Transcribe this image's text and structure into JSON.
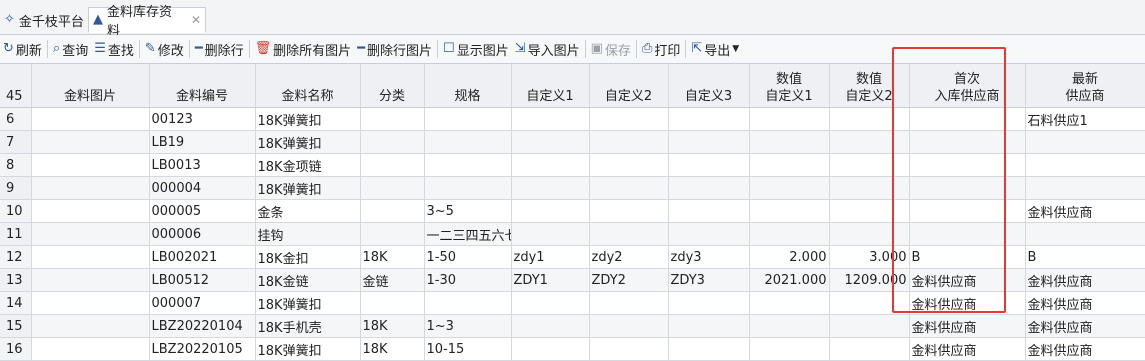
{
  "tabs": {
    "home_label": "金千枝平台",
    "active_label": "金料库存资料",
    "close_glyph": "✕"
  },
  "toolbar": {
    "refresh": "刷新",
    "query": "查询",
    "find": "查找",
    "edit": "修改",
    "delete_row": "删除行",
    "delete_all_images": "删除所有图片",
    "delete_row_image": "删除行图片",
    "show_image": "显示图片",
    "import_image": "导入图片",
    "save": "保存",
    "print": "打印",
    "export": "导出"
  },
  "grid": {
    "row_count": "45",
    "columns": {
      "image": "金料图片",
      "code": "金料编号",
      "name": "金料名称",
      "category": "分类",
      "spec": "规格",
      "custom1": "自定义1",
      "custom2": "自定义2",
      "custom3": "自定义3",
      "num1_l1": "数值",
      "num1_l2": "自定义1",
      "num2_l1": "数值",
      "num2_l2": "自定义2",
      "first_l1": "首次",
      "first_l2": "入库供应商",
      "latest_l1": "最新",
      "latest_l2": "供应商"
    },
    "rows": [
      {
        "n": "6",
        "code": "00123",
        "name": "18K弹簧扣",
        "cat": "",
        "spec": "",
        "c1": "",
        "c2": "",
        "c3": "",
        "v1": "",
        "v2": "",
        "first": "",
        "latest": "石料供应1"
      },
      {
        "n": "7",
        "code": "LB19",
        "name": "18K弹簧扣",
        "cat": "",
        "spec": "",
        "c1": "",
        "c2": "",
        "c3": "",
        "v1": "",
        "v2": "",
        "first": "",
        "latest": ""
      },
      {
        "n": "8",
        "code": "LB0013",
        "name": "18K金项链",
        "cat": "",
        "spec": "",
        "c1": "",
        "c2": "",
        "c3": "",
        "v1": "",
        "v2": "",
        "first": "",
        "latest": ""
      },
      {
        "n": "9",
        "code": "000004",
        "name": "18K弹簧扣",
        "cat": "",
        "spec": "",
        "c1": "",
        "c2": "",
        "c3": "",
        "v1": "",
        "v2": "",
        "first": "",
        "latest": ""
      },
      {
        "n": "10",
        "code": "000005",
        "name": "金条",
        "cat": "",
        "spec": "3~5",
        "c1": "",
        "c2": "",
        "c3": "",
        "v1": "",
        "v2": "",
        "first": "",
        "latest": "金料供应商"
      },
      {
        "n": "11",
        "code": "000006",
        "name": "挂钩",
        "cat": "",
        "spec": "一二三四五六七",
        "c1": "",
        "c2": "",
        "c3": "",
        "v1": "",
        "v2": "",
        "first": "",
        "latest": ""
      },
      {
        "n": "12",
        "code": "LB002021",
        "name": "18K金扣",
        "cat": "18K",
        "spec": "1-50",
        "c1": "zdy1",
        "c2": "zdy2",
        "c3": "zdy3",
        "v1": "2.000",
        "v2": "3.000",
        "first": "B",
        "latest": "B"
      },
      {
        "n": "13",
        "code": "LB00512",
        "name": "18K金链",
        "cat": "金链",
        "spec": "1-30",
        "c1": "ZDY1",
        "c2": "ZDY2",
        "c3": "ZDY3",
        "v1": "2021.000",
        "v2": "1209.000",
        "first": "金料供应商",
        "latest": "金料供应商"
      },
      {
        "n": "14",
        "code": "000007",
        "name": "18K弹簧扣",
        "cat": "",
        "spec": "",
        "c1": "",
        "c2": "",
        "c3": "",
        "v1": "",
        "v2": "",
        "first": "金料供应商",
        "latest": "金料供应商"
      },
      {
        "n": "15",
        "code": "LBZ20220104",
        "name": "18K手机壳",
        "cat": "18K",
        "spec": "1~3",
        "c1": "",
        "c2": "",
        "c3": "",
        "v1": "",
        "v2": "",
        "first": "金料供应商",
        "latest": "金料供应商"
      },
      {
        "n": "16",
        "code": "LBZ20220105",
        "name": "18K弹簧扣",
        "cat": "18K",
        "spec": "10-15",
        "c1": "",
        "c2": "",
        "c3": "",
        "v1": "",
        "v2": "",
        "first": "金料供应商",
        "latest": "金料供应商"
      }
    ]
  },
  "colors": {
    "highlight_border": "#e53935",
    "toolbar_icon": "#2d5a99",
    "delete_icon": "#d33"
  }
}
